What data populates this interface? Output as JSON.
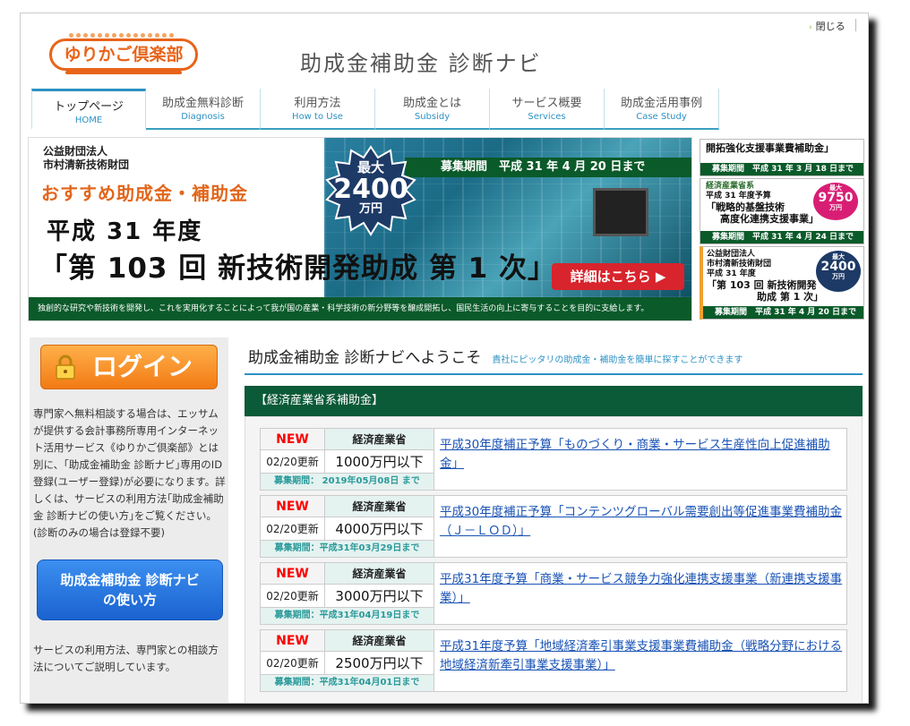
{
  "header": {
    "close_label": "閉じる",
    "close_chevron": "›",
    "logo_text": "ゆりかご倶楽部",
    "site_title": "助成金補助金  診断ナビ"
  },
  "nav": [
    {
      "jp": "トップページ",
      "en": "HOME"
    },
    {
      "jp": "助成金無料診断",
      "en": "Diagnosis"
    },
    {
      "jp": "利用方法",
      "en": "How to Use"
    },
    {
      "jp": "助成金とは",
      "en": "Subsidy"
    },
    {
      "jp": "サービス概要",
      "en": "Services"
    },
    {
      "jp": "助成金活用事例",
      "en": "Case Study"
    }
  ],
  "hero": {
    "org_line1": "公益財団法人",
    "org_line2": "市村清新技術財団",
    "recommend": "おすすめ助成金・補助金",
    "year": "平成 31 年度",
    "name": "「第 103 回  新技術開発助成  第 1 次」",
    "badge_max": "最大",
    "badge_amount": "2400",
    "badge_unit": "万円",
    "recruit": "募集期間　平成 31 年 4 月 20 日まで",
    "detail_button": "詳細はこちら ▶",
    "footer": "独創的な研究や新技術を開発し、これを実用化することによって我が国の産業・科学技術の新分野等を醸成開拓し、国民生活の向上に寄与することを目的に支給します。"
  },
  "side_ads": [
    {
      "title": "開拓強化支援事業費補助金」",
      "period": "募集期間　平成 31 年 3 月 18 日まで"
    },
    {
      "org": "経済産業省系",
      "year": "平成 31 年度予算",
      "title1": "「戦略的基盤技術",
      "title2": "高度化連携支援事業」",
      "badge_max": "最大",
      "badge_amount": "9750",
      "badge_unit": "万円",
      "period": "募集期間　平成 31 年 4 月 24 日まで"
    },
    {
      "org1": "公益財団法人",
      "org2": "市村清新技術財団",
      "year": "平成 31 年度",
      "title1": "「第 103 回  新技術開発",
      "title2": "助成 第 1 次」",
      "badge_max": "最大",
      "badge_amount": "2400",
      "badge_unit": "万円",
      "period": "募集期間　平成 31 年 4 月 20 日まで"
    }
  ],
  "sidebar": {
    "login_label": "ログイン",
    "login_text": "専門家へ無料相談する場合は、エッサムが提供する会計事務所専用インターネット活用サービス《ゆりかご倶楽部》とは別に、｢助成金補助金 診断ナビ｣専用のID登録(ユーザー登録)が必要になります。詳しくは、サービスの利用方法｢助成金補助金 診断ナビの使い方｣をご覧ください。(診断のみの場合は登録不要)",
    "howto_line1": "助成金補助金 診断ナビ",
    "howto_line2": "の使い方",
    "howto_text": "サービスの利用方法、専門家との相談方法についてご説明しています。"
  },
  "main": {
    "welcome_title": "助成金補助金 診断ナビへようこそ",
    "welcome_sub": "貴社にピッタリの助成金・補助金を簡単に探すことができます",
    "section_title": "【経済産業省系補助金】"
  },
  "grants": [
    {
      "badge": "NEW",
      "ministry": "経済産業省",
      "updated": "02/20更新",
      "amount": "1000万円以下",
      "period": "募集期間： 2019年05月08日 まで",
      "title": "平成30年度補正予算「ものづくり・商業・サービス生産性向上促進補助金」"
    },
    {
      "badge": "NEW",
      "ministry": "経済産業省",
      "updated": "02/20更新",
      "amount": "4000万円以下",
      "period": "募集期間：平成31年03月29日まで",
      "title": "平成30年度補正予算「コンテンツグローバル需要創出等促進事業費補助金（Ｊ－ＬＯＤ）」"
    },
    {
      "badge": "NEW",
      "ministry": "経済産業省",
      "updated": "02/20更新",
      "amount": "3000万円以下",
      "period": "募集期間：平成31年04月19日まで",
      "title": "平成31年度予算「商業・サービス競争力強化連携支援事業（新連携支援事業）」"
    },
    {
      "badge": "NEW",
      "ministry": "経済産業省",
      "updated": "02/20更新",
      "amount": "2500万円以下",
      "period": "募集期間：平成31年04月01日まで",
      "title": "平成31年度予算「地域経済牽引事業支援事業費補助金（戦略分野における地域経済新牽引事業支援事業）」"
    }
  ],
  "colors": {
    "brand_orange": "#e8641a",
    "nav_blue": "#2d91c5",
    "section_green": "#0b5a38",
    "new_red": "#ff0000",
    "link_blue": "#1a53b5"
  }
}
